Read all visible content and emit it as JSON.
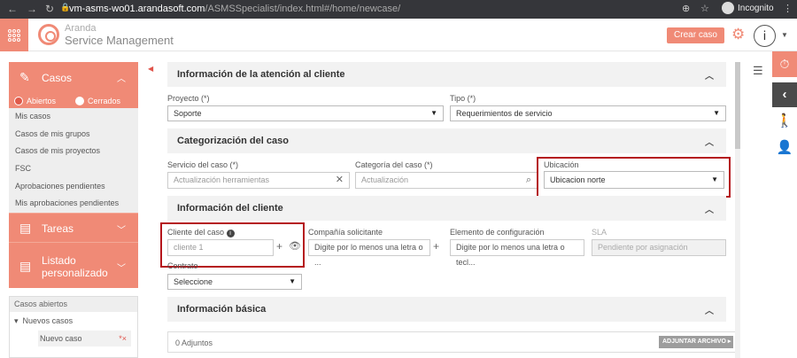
{
  "browser": {
    "url_host": "vm-asms-wo01.arandasoft.com",
    "url_path": "/ASMSSpecialist/index.html#/home/newcase/",
    "incognito_label": "Incognito"
  },
  "header": {
    "brand_line1": "Aranda",
    "brand_line2": "Service Management",
    "create_case_label": "Crear caso"
  },
  "sidebar": {
    "casos_label": "Casos",
    "tab_open": "Abiertos",
    "tab_closed": "Cerrados",
    "items": [
      "Mis casos",
      "Casos de mis grupos",
      "Casos de mis proyectos",
      "FSC",
      "Aprobaciones pendientes",
      "Mis aprobaciones pendientes"
    ],
    "tareas_label": "Tareas",
    "listado_line1": "Listado",
    "listado_line2": "personalizado",
    "tree_header": "Casos abiertos",
    "tree_node": "Nuevos casos",
    "tree_leaf": "Nuevo caso",
    "tree_leaf_mark": "*×"
  },
  "sections": {
    "atencion": "Información de la atención al cliente",
    "categorizacion": "Categorización del caso",
    "cliente": "Información del cliente",
    "basica": "Información básica"
  },
  "form": {
    "proyecto_label": "Proyecto (*)",
    "proyecto_value": "Soporte",
    "tipo_label": "Tipo (*)",
    "tipo_value": "Requerimientos de servicio",
    "servicio_label": "Servicio del caso (*)",
    "servicio_placeholder": "Actualización herramientas",
    "categoria_label": "Categoría del caso (*)",
    "categoria_placeholder": "Actualización",
    "ubicacion_label": "Ubicación",
    "ubicacion_value": "Ubicacion norte",
    "cliente_label": "Cliente del caso",
    "cliente_placeholder": "cliente 1",
    "compania_label": "Compañía solicitante",
    "compania_placeholder": "Digite por lo menos una letra o ...",
    "elemento_label": "Elemento de configuración",
    "elemento_placeholder": "Digite por lo menos una letra o tecl...",
    "sla_label": "SLA",
    "sla_placeholder": "Pendiente por asignación",
    "contrato_label": "Contrato",
    "contrato_value": "Seleccione"
  },
  "attachments": {
    "count_label": "0 Adjuntos",
    "button_label": "ADJUNTAR ARCHIVO ▸"
  },
  "colors": {
    "accent": "#f08a76",
    "highlight": "#b5151b"
  }
}
